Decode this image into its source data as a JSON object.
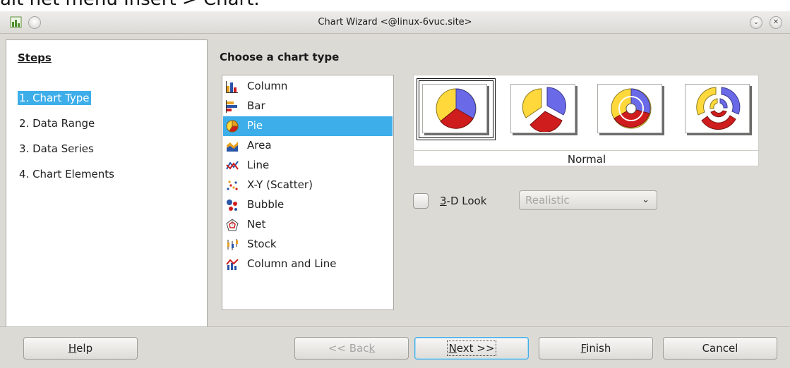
{
  "background_caption": "ait het menu Insert > Chart.",
  "window": {
    "title": "Chart Wizard <@linux-6vuc.site>"
  },
  "steps": {
    "heading": "Steps",
    "items": [
      {
        "label": "1. Chart Type",
        "active": true
      },
      {
        "label": "2. Data Range",
        "active": false
      },
      {
        "label": "3. Data Series",
        "active": false
      },
      {
        "label": "4. Chart Elements",
        "active": false
      }
    ]
  },
  "main": {
    "heading": "Choose a chart type",
    "chart_types": [
      {
        "label": "Column",
        "icon": "column-chart-icon"
      },
      {
        "label": "Bar",
        "icon": "bar-chart-icon"
      },
      {
        "label": "Pie",
        "icon": "pie-chart-icon",
        "selected": true
      },
      {
        "label": "Area",
        "icon": "area-chart-icon"
      },
      {
        "label": "Line",
        "icon": "line-chart-icon"
      },
      {
        "label": "X-Y (Scatter)",
        "icon": "scatter-chart-icon"
      },
      {
        "label": "Bubble",
        "icon": "bubble-chart-icon"
      },
      {
        "label": "Net",
        "icon": "net-chart-icon"
      },
      {
        "label": "Stock",
        "icon": "stock-chart-icon"
      },
      {
        "label": "Column and Line",
        "icon": "column-and-line-chart-icon"
      }
    ],
    "variant_label": "Normal",
    "variants": [
      "normal-pie-icon",
      "exploded-pie-icon",
      "donut-icon",
      "exploded-donut-icon"
    ],
    "three_d_label": "3-D Look",
    "three_d_checked": false,
    "shape_select": "Realistic"
  },
  "buttons": {
    "help": "Help",
    "back": "<< Back",
    "next": "Next >>",
    "finish": "Finish",
    "cancel": "Cancel"
  },
  "colors": {
    "selection": "#3daee9",
    "pie_yellow": "#ffd83c",
    "pie_blue": "#6a6ae8",
    "pie_red": "#cf1d1d"
  }
}
